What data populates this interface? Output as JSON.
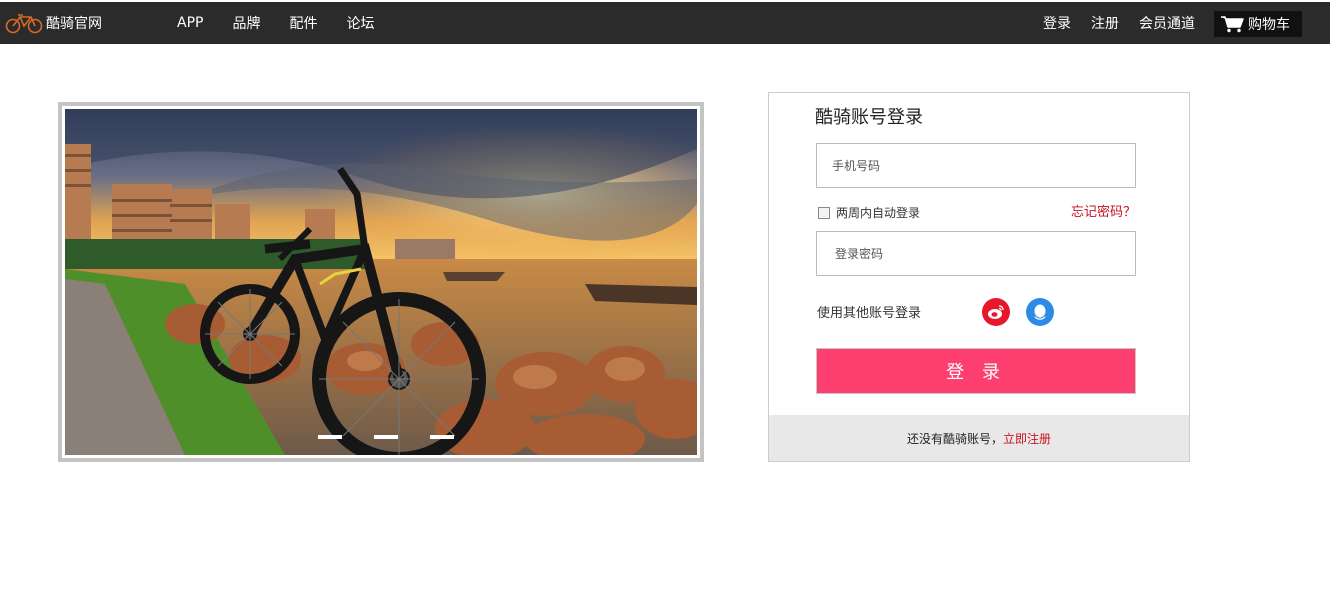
{
  "header": {
    "brand": "酷骑官网",
    "nav": [
      "APP",
      "品牌",
      "配件",
      "论坛"
    ],
    "login": "登录",
    "register": "注册",
    "member": "会员通道",
    "cart": "购物车"
  },
  "slider": {
    "slide_count": 3,
    "icons": [
      "bicycle-photo"
    ]
  },
  "login": {
    "title": "酷骑账号登录",
    "phone_placeholder": "手机号码",
    "remember_label": "两周内自动登录",
    "forgot_label": "忘记密码？",
    "password_placeholder": "登录密码",
    "other_label": "使用其他账号登录",
    "button_label": "登 录",
    "footer_text": "还没有酷骑账号，",
    "footer_link": "立即注册"
  },
  "colors": {
    "nav_bg": "#2b2b2b",
    "accent": "#fd3f70",
    "link_red": "#c8101e",
    "weibo": "#e6162d",
    "qq": "#2d8ae6"
  }
}
